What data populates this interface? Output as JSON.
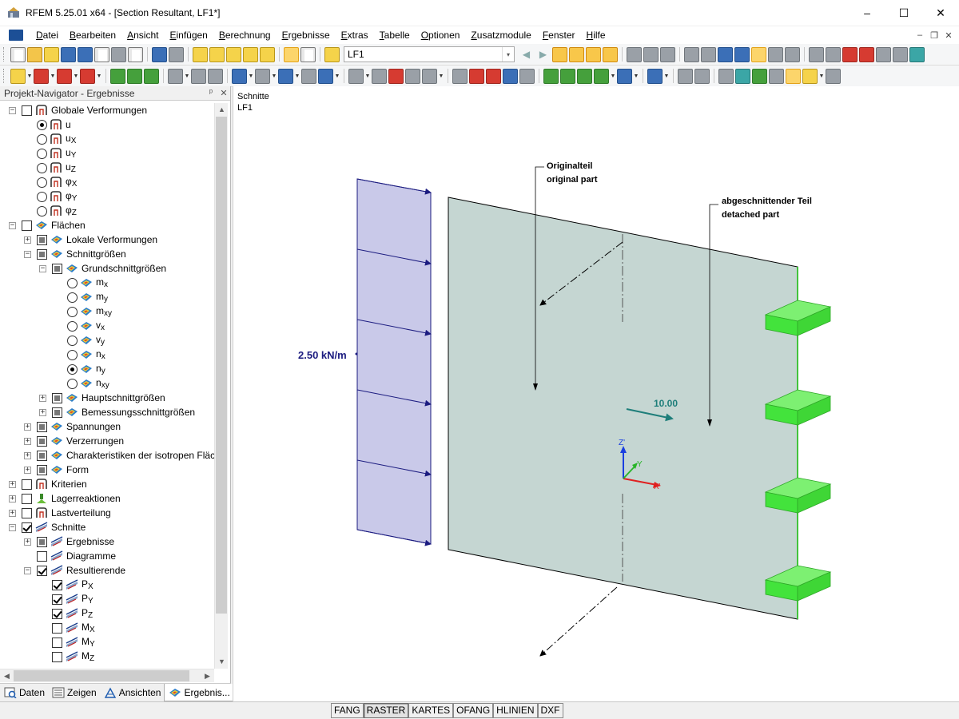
{
  "window": {
    "title": "RFEM 5.25.01 x64 - [Section Resultant, LF1*]",
    "controls": {
      "minimize": "–",
      "maximize": "☐",
      "close": "✕"
    }
  },
  "menu": {
    "items": [
      {
        "ul": "D",
        "rest": "atei"
      },
      {
        "ul": "B",
        "rest": "earbeiten"
      },
      {
        "ul": "A",
        "rest": "nsicht"
      },
      {
        "ul": "E",
        "rest": "infügen"
      },
      {
        "ul": "B",
        "rest": "erechnung"
      },
      {
        "ul": "E",
        "rest": "rgebnisse"
      },
      {
        "ul": "E",
        "rest": "xtras"
      },
      {
        "ul": "T",
        "rest": "abelle"
      },
      {
        "ul": "O",
        "rest": "ptionen"
      },
      {
        "ul": "Z",
        "rest": "usatzmodule"
      },
      {
        "ul": "F",
        "rest": "enster"
      },
      {
        "ul": "H",
        "rest": "ilfe"
      }
    ],
    "mdi_controls": {
      "minimize": "–",
      "restore": "❐",
      "close": "✕"
    }
  },
  "toolbar": {
    "loadcase_value": "LF1",
    "loadcase_arrow": "▾"
  },
  "navigator": {
    "title": "Projekt-Navigator - Ergebnisse",
    "header_pin": "ᵖ",
    "header_close": "✕",
    "tree": [
      {
        "indent": 0,
        "toggle": "−",
        "check": "none",
        "icon": "deform",
        "label": "Globale Verformungen"
      },
      {
        "indent": 1,
        "toggle": "",
        "radio": "selected",
        "icon": "deform",
        "label": "u"
      },
      {
        "indent": 1,
        "toggle": "",
        "radio": "off",
        "icon": "deform",
        "label": "u",
        "sub": "X"
      },
      {
        "indent": 1,
        "toggle": "",
        "radio": "off",
        "icon": "deform",
        "label": "u",
        "sub": "Y"
      },
      {
        "indent": 1,
        "toggle": "",
        "radio": "off",
        "icon": "deform",
        "label": "u",
        "sub": "Z"
      },
      {
        "indent": 1,
        "toggle": "",
        "radio": "off",
        "icon": "deform",
        "label": "φ",
        "sub": "X"
      },
      {
        "indent": 1,
        "toggle": "",
        "radio": "off",
        "icon": "deform",
        "label": "φ",
        "sub": "Y"
      },
      {
        "indent": 1,
        "toggle": "",
        "radio": "off",
        "icon": "deform",
        "label": "φ",
        "sub": "Z"
      },
      {
        "indent": 0,
        "toggle": "−",
        "check": "none",
        "icon": "surface",
        "label": "Flächen"
      },
      {
        "indent": 1,
        "toggle": "+",
        "check": "partial",
        "icon": "surface",
        "label": "Lokale Verformungen"
      },
      {
        "indent": 1,
        "toggle": "−",
        "check": "partial",
        "icon": "surface",
        "label": "Schnittgrößen"
      },
      {
        "indent": 2,
        "toggle": "−",
        "check": "partial",
        "icon": "surface",
        "label": "Grundschnittgrößen"
      },
      {
        "indent": 3,
        "toggle": "",
        "radio": "off",
        "icon": "surface",
        "label": "m",
        "sub": "x"
      },
      {
        "indent": 3,
        "toggle": "",
        "radio": "off",
        "icon": "surface",
        "label": "m",
        "sub": "y"
      },
      {
        "indent": 3,
        "toggle": "",
        "radio": "off",
        "icon": "surface",
        "label": "m",
        "sub": "xy"
      },
      {
        "indent": 3,
        "toggle": "",
        "radio": "off",
        "icon": "surface",
        "label": "v",
        "sub": "x"
      },
      {
        "indent": 3,
        "toggle": "",
        "radio": "off",
        "icon": "surface",
        "label": "v",
        "sub": "y"
      },
      {
        "indent": 3,
        "toggle": "",
        "radio": "off",
        "icon": "surface",
        "label": "n",
        "sub": "x"
      },
      {
        "indent": 3,
        "toggle": "",
        "radio": "selected",
        "icon": "surface",
        "label": "n",
        "sub": "y"
      },
      {
        "indent": 3,
        "toggle": "",
        "radio": "off",
        "icon": "surface",
        "label": "n",
        "sub": "xy"
      },
      {
        "indent": 2,
        "toggle": "+",
        "check": "partial",
        "icon": "surface",
        "label": "Hauptschnittgrößen"
      },
      {
        "indent": 2,
        "toggle": "+",
        "check": "partial",
        "icon": "surface",
        "label": "Bemessungsschnittgrößen"
      },
      {
        "indent": 1,
        "toggle": "+",
        "check": "partial",
        "icon": "surface",
        "label": "Spannungen"
      },
      {
        "indent": 1,
        "toggle": "+",
        "check": "partial",
        "icon": "surface",
        "label": "Verzerrungen"
      },
      {
        "indent": 1,
        "toggle": "+",
        "check": "partial",
        "icon": "surface",
        "label": "Charakteristiken der isotropen Fläc"
      },
      {
        "indent": 1,
        "toggle": "+",
        "check": "partial",
        "icon": "surface",
        "label": "Form"
      },
      {
        "indent": 0,
        "toggle": "+",
        "check": "none",
        "icon": "deform",
        "label": "Kriterien"
      },
      {
        "indent": 0,
        "toggle": "+",
        "check": "none",
        "icon": "support",
        "label": "Lagerreaktionen"
      },
      {
        "indent": 0,
        "toggle": "+",
        "check": "none",
        "icon": "deform",
        "label": "Lastverteilung"
      },
      {
        "indent": 0,
        "toggle": "−",
        "check": "checked",
        "icon": "section",
        "label": "Schnitte"
      },
      {
        "indent": 1,
        "toggle": "+",
        "check": "partial",
        "icon": "section",
        "label": "Ergebnisse"
      },
      {
        "indent": 1,
        "toggle": "",
        "check": "none",
        "icon": "section",
        "label": "Diagramme"
      },
      {
        "indent": 1,
        "toggle": "−",
        "check": "checked",
        "icon": "section",
        "label": "Resultierende"
      },
      {
        "indent": 2,
        "toggle": "",
        "check": "checked",
        "icon": "section",
        "label": "P",
        "sub": "X"
      },
      {
        "indent": 2,
        "toggle": "",
        "check": "checked",
        "icon": "section",
        "label": "P",
        "sub": "Y"
      },
      {
        "indent": 2,
        "toggle": "",
        "check": "checked",
        "icon": "section",
        "label": "P",
        "sub": "Z"
      },
      {
        "indent": 2,
        "toggle": "",
        "check": "none",
        "icon": "section",
        "label": "M",
        "sub": "X"
      },
      {
        "indent": 2,
        "toggle": "",
        "check": "none",
        "icon": "section",
        "label": "M",
        "sub": "Y"
      },
      {
        "indent": 2,
        "toggle": "",
        "check": "none",
        "icon": "section",
        "label": "M",
        "sub": "Z"
      }
    ],
    "tabs": [
      {
        "label": "Daten",
        "icon": "data",
        "active": false
      },
      {
        "label": "Zeigen",
        "icon": "show",
        "active": false
      },
      {
        "label": "Ansichten",
        "icon": "views",
        "active": false
      },
      {
        "label": "Ergebnis...",
        "icon": "results",
        "active": true
      }
    ],
    "scroll": {
      "up": "▲",
      "down": "▼",
      "left": "◀",
      "right": "▶"
    }
  },
  "viewport": {
    "info_line1": "Schnitte",
    "info_line2": "LF1",
    "load_label": "2.50 kN/m",
    "annotation_original_1": "Originalteil",
    "annotation_original_2": "original part",
    "annotation_detached_1": "abgeschnittender Teil",
    "annotation_detached_2": "detached part",
    "resultant_value": "10.00",
    "axis_z": "Z'",
    "axis_y": "Y",
    "axis_x": "X'",
    "colors": {
      "plate": "#c5d6d2",
      "load": "#c9c9e9",
      "load_stroke": "#1c1c80",
      "support": "#43e33c",
      "resultant": "#1e7e7a"
    }
  },
  "statusbar": {
    "buttons": [
      {
        "label": "FANG",
        "pressed": false
      },
      {
        "label": "RASTER",
        "pressed": true
      },
      {
        "label": "KARTES",
        "pressed": false
      },
      {
        "label": "OFANG",
        "pressed": false
      },
      {
        "label": "HLINIEN",
        "pressed": false
      },
      {
        "label": "DXF",
        "pressed": false
      }
    ]
  }
}
